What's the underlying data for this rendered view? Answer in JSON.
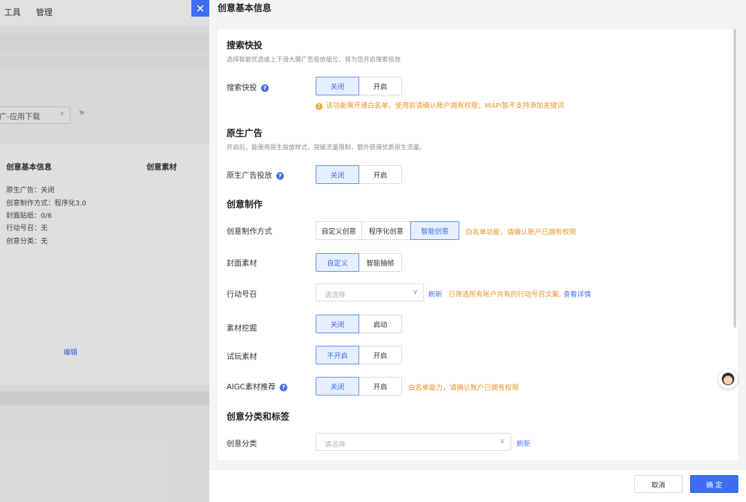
{
  "background": {
    "menu": [
      "工具",
      "管理"
    ],
    "select_value": "广-应用下载",
    "expand_glyph": "»",
    "columns": [
      "创意基本信息",
      "创意素材"
    ],
    "info_lines": [
      "原生广告：关闭",
      "创意制作方式：程序化3.0",
      "封面贴纸：0/6",
      "行动号召：无",
      "创意分类：无"
    ],
    "edit_link": "编辑"
  },
  "drawer": {
    "close_glyph": "✕",
    "title": "创意基本信息",
    "search_quick": {
      "title": "搜索快投",
      "desc": "选择智能优选或上下滑大屏广告投放版位，将为您开启搜索投放",
      "label": "搜索快投",
      "options": [
        "关闭",
        "开启"
      ],
      "warning": "该功能需开通白名单，使用前请确认账户拥有权限；MAPI暂不支持添加关键词"
    },
    "native_ad": {
      "title": "原生广告",
      "desc": "开启后，能使用原生投放样式，突破流量限制，额外获得优质原生流量。",
      "label": "原生广告投放",
      "options": [
        "关闭",
        "开启"
      ]
    },
    "creative_make": {
      "title": "创意制作",
      "method_label": "创意制作方式",
      "method_options": [
        "自定义创意",
        "程序化创意",
        "智能创意"
      ],
      "method_note": "白名单功能，请确认账户已拥有权限",
      "cover_label": "封面素材",
      "cover_options": [
        "自定义",
        "智能抽帧"
      ],
      "cta_label": "行动号召",
      "cta_placeholder": "请选择",
      "cta_refresh": "刷新",
      "cta_note": "已筛选所有账户共有的行动号召文案,",
      "cta_detail": "查看详情",
      "mining_label": "素材挖掘",
      "mining_options": [
        "关闭",
        "启动"
      ],
      "trial_label": "试玩素材",
      "trial_options": [
        "不开启",
        "开启"
      ],
      "aigc_label": "AIGC素材推荐",
      "aigc_options": [
        "关闭",
        "开启"
      ],
      "aigc_note": "白名单能力，请确认账户已拥有权限"
    },
    "category": {
      "title": "创意分类和标签",
      "label": "创意分类",
      "placeholder": "请选择",
      "refresh": "刷新"
    },
    "footer": {
      "cancel": "取消",
      "ok": "确 定"
    }
  },
  "colors": {
    "accent": "#3d6ef0",
    "warning": "#e8942a",
    "active_bg": "#e6efff"
  }
}
